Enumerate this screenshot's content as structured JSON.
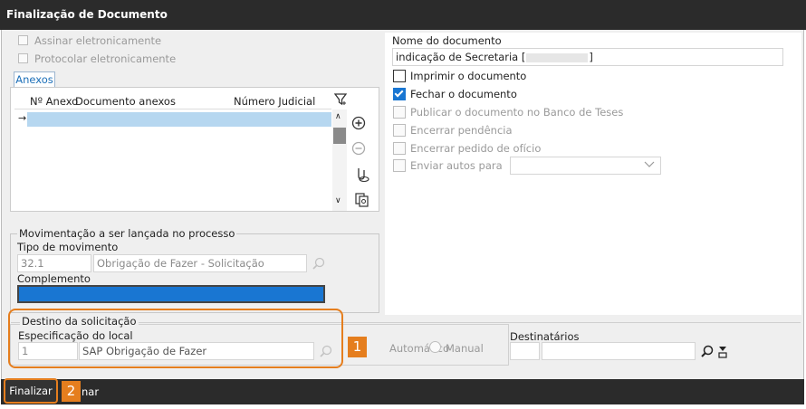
{
  "window": {
    "title": "Finalização de Documento"
  },
  "left": {
    "sign_electronically": "Assinar eletronicamente",
    "file_electronically": "Protocolar eletronicamente",
    "tab_label": "Anexos",
    "grid_headers": [
      "Nº Anexo",
      "Documento anexos",
      "Número Judicial"
    ]
  },
  "movement": {
    "group_title": "Movimentação a ser lançada no processo",
    "type_label": "Tipo de movimento",
    "type_code": "32.1",
    "type_desc": "Obrigação de Fazer - Solicitação",
    "complement_label": "Complemento"
  },
  "destination": {
    "group_title": "Destino da solicitação",
    "local_label": "Especificação do local",
    "local_code": "1",
    "local_desc": "SAP Obrigação de Fazer",
    "automatic_label": "Automático",
    "manual_label": "Manual",
    "recipients_label": "Destinatários"
  },
  "right": {
    "doc_name_label": "Nome do documento",
    "doc_name_value": "indicação de Secretaria [",
    "doc_name_suffix": "]",
    "print_doc": "Imprimir o documento",
    "close_doc": "Fechar o documento",
    "publish_doc": "Publicar o documento no Banco de Teses",
    "close_pending": "Encerrar pendência",
    "close_office": "Encerrar pedido de ofício",
    "send_records": "Enviar autos para"
  },
  "footer": {
    "finalize_button": "Finalizar",
    "cancel_partial": "nar"
  },
  "annotations": {
    "badge1": "1",
    "badge2": "2"
  },
  "colors": {
    "accent": "#e57e1e",
    "selection": "#1976d2",
    "titlebar": "#2b2b2b"
  }
}
